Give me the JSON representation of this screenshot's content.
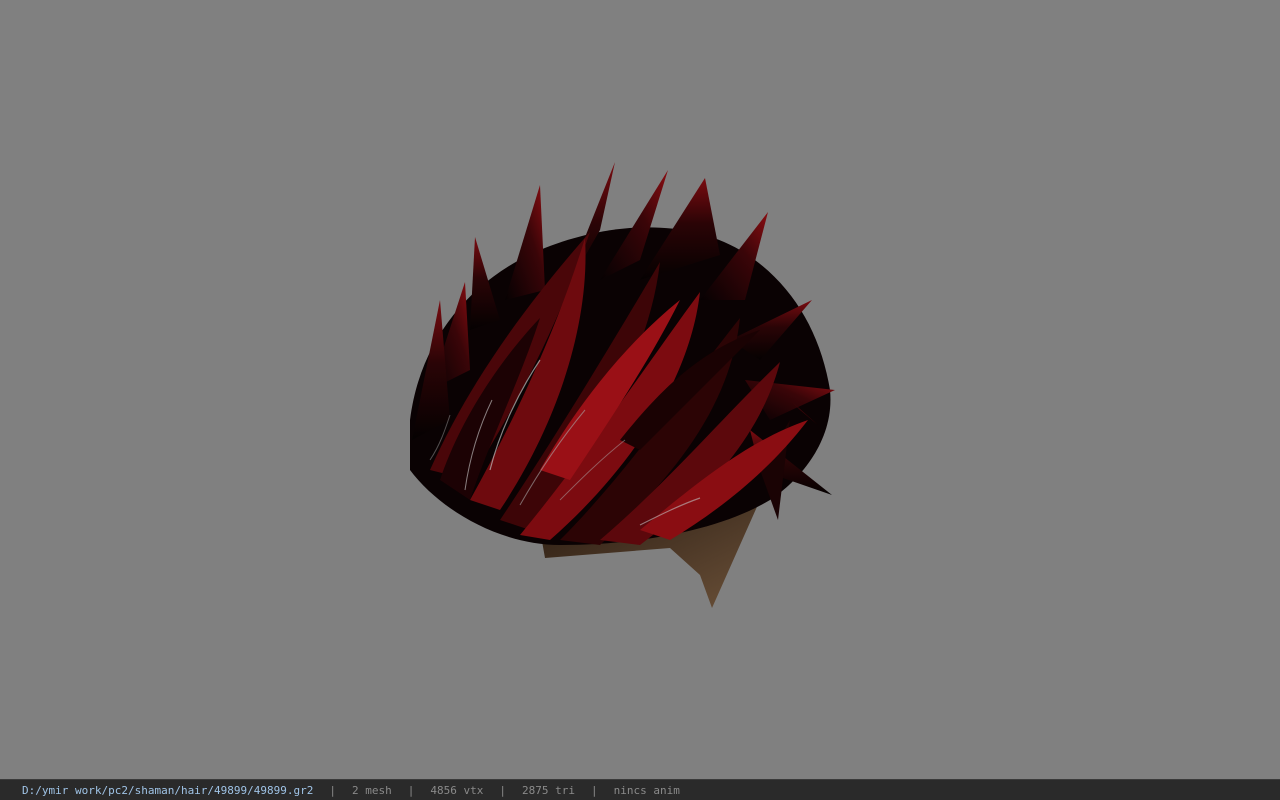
{
  "viewer": {
    "background_color": "#808080",
    "model_icon": "hair-mesh-icon",
    "hair_colors": {
      "dark": "#0b0203",
      "mid": "#3a0508",
      "highlight": "#8a0d12",
      "shine": "#c8c8c8",
      "shadow": "#5a4430"
    }
  },
  "status": {
    "file_path": "D:/ymir work/pc2/shaman/hair/49899/49899.gr2",
    "separator": "|",
    "mesh_count": "2 mesh",
    "vertex_count": "4856 vtx",
    "triangle_count": "2875 tri",
    "anim_status": "nincs anim"
  }
}
